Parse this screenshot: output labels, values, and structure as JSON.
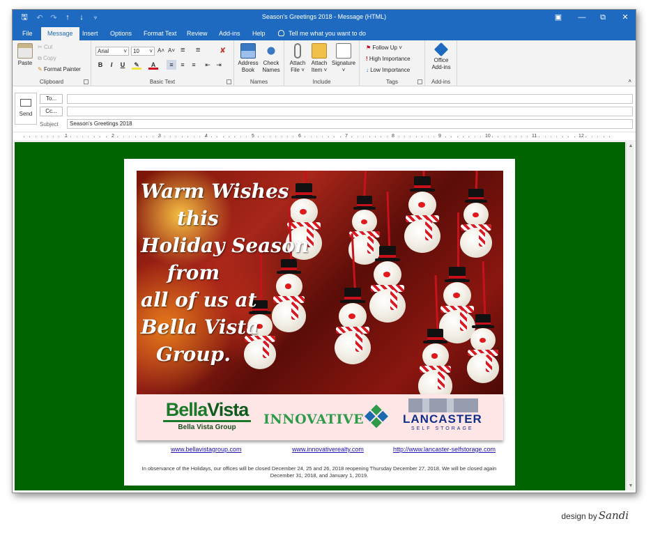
{
  "window": {
    "title": "Season's Greetings 2018  -  Message (HTML)",
    "titlebar_color": "#1e6ac0"
  },
  "tabs": [
    {
      "label": "File"
    },
    {
      "label": "Message",
      "active": true
    },
    {
      "label": "Insert"
    },
    {
      "label": "Options"
    },
    {
      "label": "Format Text"
    },
    {
      "label": "Review"
    },
    {
      "label": "Add-ins"
    },
    {
      "label": "Help"
    }
  ],
  "tell_me": "Tell me what you want to do",
  "ribbon": {
    "clipboard": {
      "paste": "Paste",
      "cut": "Cut",
      "copy": "Copy",
      "format_painter": "Format Painter",
      "label": "Clipboard"
    },
    "basic_text": {
      "font": "Arial",
      "size": "10",
      "grow": "A˄",
      "shrink": "A˅",
      "bold": "B",
      "italic": "I",
      "underline": "U",
      "label": "Basic Text"
    },
    "names": {
      "address_book_1": "Address",
      "address_book_2": "Book",
      "check_names_1": "Check",
      "check_names_2": "Names",
      "label": "Names"
    },
    "include": {
      "attach_file_1": "Attach",
      "attach_file_2": "File ˅",
      "attach_item_1": "Attach",
      "attach_item_2": "Item ˅",
      "signature_1": "Signature",
      "signature_2": "˅",
      "label": "Include"
    },
    "tags": {
      "follow_up": "Follow Up ˅",
      "high": "High Importance",
      "low": "Low Importance",
      "label": "Tags"
    },
    "addins": {
      "office_1": "Office",
      "office_2": "Add-ins",
      "label": "Add-ins"
    }
  },
  "header": {
    "send": "Send",
    "to": "To...",
    "cc": "Cc...",
    "subject_label": "Subject",
    "subject_value": "Season's Greetings 2018"
  },
  "ruler": [
    "1",
    "2",
    "3",
    "4",
    "5",
    "6",
    "7",
    "8",
    "9",
    "10",
    "11",
    "12"
  ],
  "email": {
    "background": "#006400",
    "greeting": [
      "Warm Wishes",
      "this",
      "Holiday Season",
      "from",
      "all of us at",
      "Bella Vista",
      "Group."
    ],
    "logos": {
      "bella_vista_1": "Bella",
      "bella_vista_2": "Vista",
      "bella_vista_sub": "Bella Vista Group",
      "innovative": "INNOVATIVE",
      "lancaster": "LANCASTER",
      "lancaster_sub": "SELF STORAGE"
    },
    "links": [
      "www.bellavistagroup.com",
      "www.innovativerealty.com",
      "http://www.lancaster-selfstorage.com"
    ],
    "notice": "In observance of the Holidays, our offices will be closed December 24, 25 and 26, 2018 reopening Thursday December 27, 2018.  We will be closed again December 31, 2018, and January 1,  2019."
  },
  "credit": {
    "text": "design by",
    "signature": "Sandi"
  }
}
